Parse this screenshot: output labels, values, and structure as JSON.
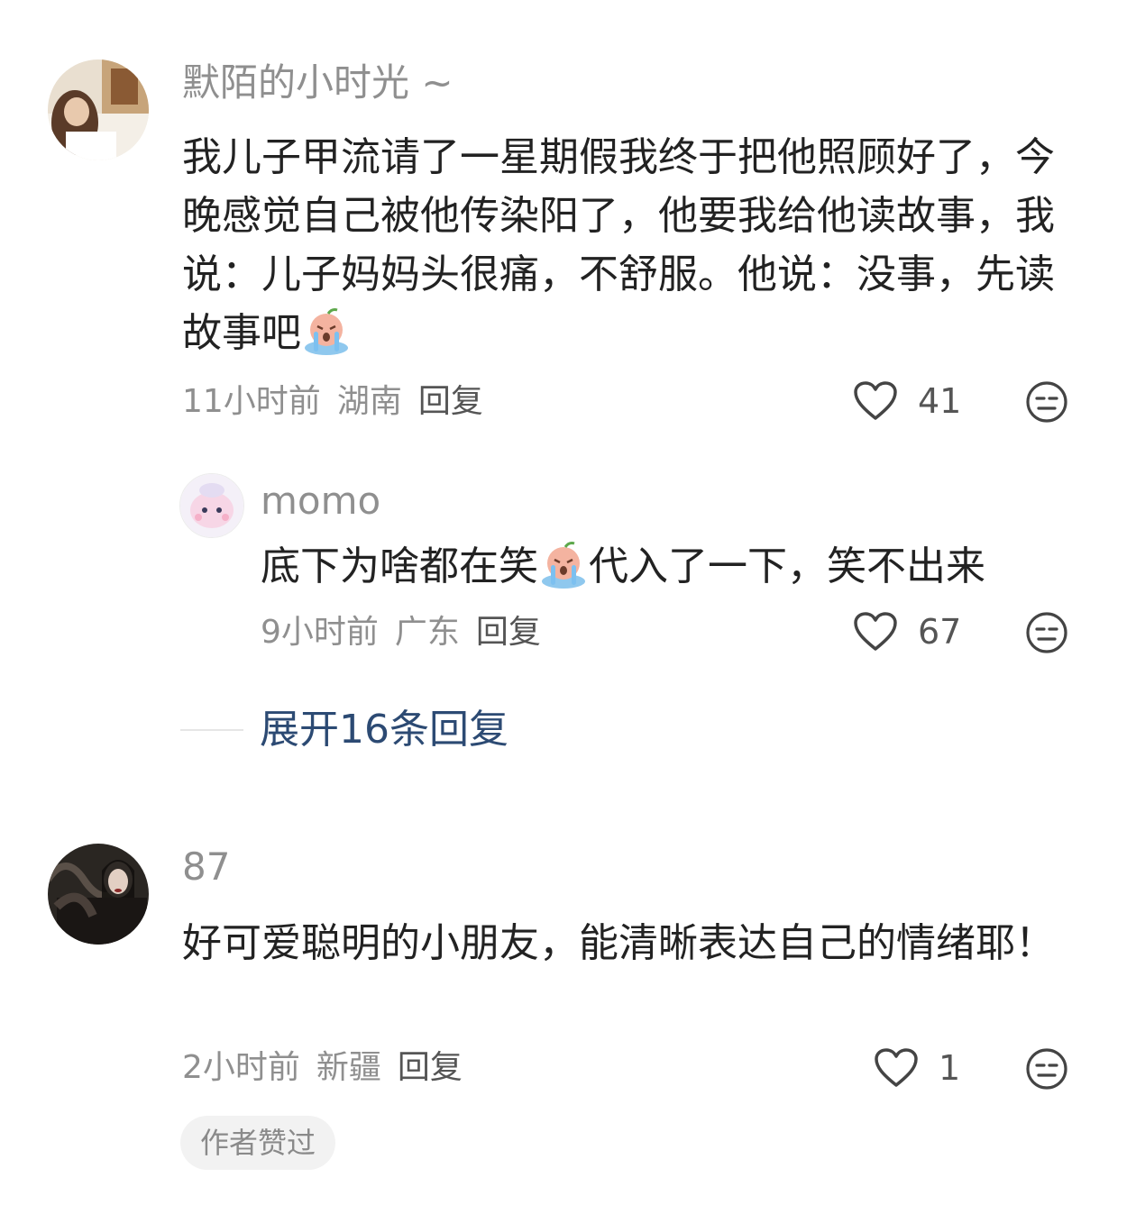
{
  "comments": [
    {
      "username": "默陌的小时光 ~",
      "text_a": "我儿子甲流请了一星期假我终于把他照顾好了，今晚感觉自己被他传染阳了，他要我给他读故事，我说：儿子妈妈头很痛，不舒服。他说：没事，先读故事吧",
      "emoji": "crying-face-emoji",
      "time": "11小时前",
      "location": "湖南",
      "reply_label": "回复",
      "likes": "41",
      "replies": [
        {
          "username": "momo",
          "text_a": "底下为啥都在笑",
          "emoji": "crying-face-emoji",
          "text_b": "代入了一下，笑不出来",
          "time": "9小时前",
          "location": "广东",
          "reply_label": "回复",
          "likes": "67"
        }
      ],
      "expand_label": "展开16条回复"
    },
    {
      "username": "87",
      "text_a": "好可爱聪明的小朋友，能清晰表达自己的情绪耶！",
      "time": "2小时前",
      "location": "新疆",
      "reply_label": "回复",
      "likes": "1",
      "badge": "作者赞过"
    }
  ],
  "icons": {
    "like": "heart-outline-icon",
    "dislike": "meh-face-icon"
  },
  "colors": {
    "username": "#8f8f8f",
    "text": "#222222",
    "meta": "#8f8f8f",
    "expand_link": "#2c4a73",
    "badge_bg": "#f2f2f2"
  }
}
